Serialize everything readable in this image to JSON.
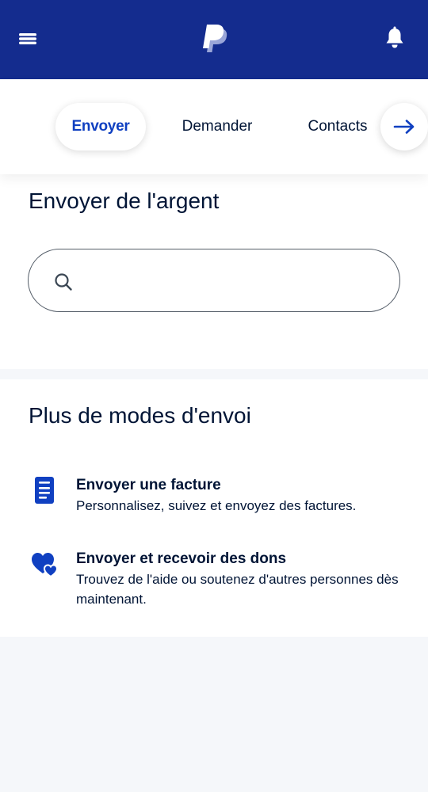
{
  "header": {
    "menu_icon": "hamburger-menu-icon",
    "logo_icon": "paypal-logo-icon",
    "bell_icon": "bell-icon",
    "colors": {
      "background": "#142c8e",
      "logo_light": "#ffffff",
      "logo_dim": "#9aa6d8"
    }
  },
  "tabs": {
    "items": [
      {
        "label": "Envoyer",
        "active": true
      },
      {
        "label": "Demander",
        "active": false
      },
      {
        "label": "Contacts",
        "active": false
      }
    ],
    "next_icon": "arrow-right-icon",
    "active_color": "#1040c1"
  },
  "send": {
    "title": "Envoyer de l'argent",
    "search": {
      "icon": "search-icon",
      "placeholder": "",
      "value": ""
    }
  },
  "more": {
    "title": "Plus de modes d'envoi",
    "options": [
      {
        "icon": "invoice-document-icon",
        "title": "Envoyer une facture",
        "description": "Personnalisez, suivez et envoyez des factures."
      },
      {
        "icon": "hearts-donation-icon",
        "title": "Envoyer et recevoir des dons",
        "description": "Trouvez de l'aide ou soutenez d'autres personnes dès maintenant."
      }
    ],
    "icon_color": "#1040c1"
  }
}
